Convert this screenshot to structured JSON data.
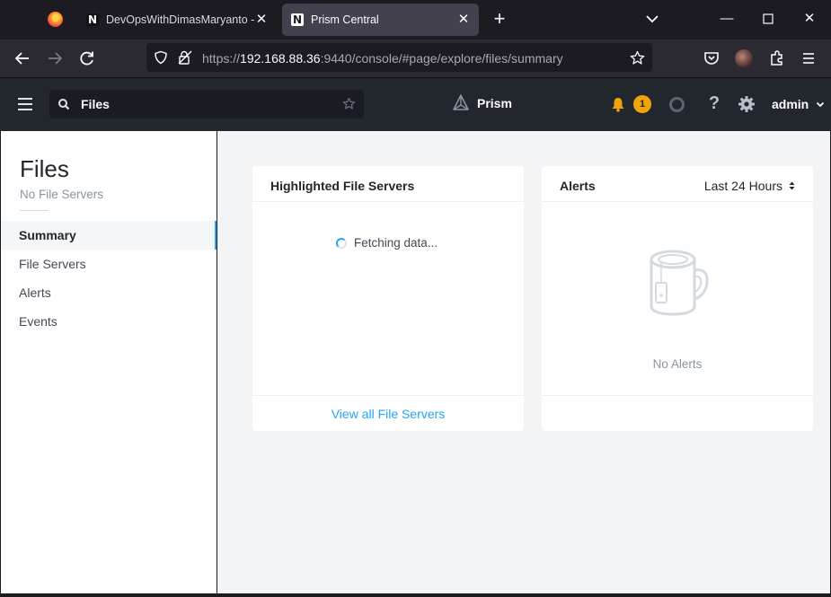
{
  "browser": {
    "tabs": [
      {
        "title": "DevOpsWithDimasMaryanto - N"
      },
      {
        "title": "Prism Central"
      }
    ],
    "url_prefix": "https://",
    "url_host": "192.168.88.36",
    "url_rest": ":9440/console/#page/explore/files/summary"
  },
  "header": {
    "search_value": "Files",
    "brand": "Prism",
    "alert_count": "1",
    "help": "?",
    "user": "admin"
  },
  "sidebar": {
    "title": "Files",
    "subtitle": "No File Servers",
    "items": [
      {
        "label": "Summary",
        "active": true
      },
      {
        "label": "File Servers"
      },
      {
        "label": "Alerts"
      },
      {
        "label": "Events"
      }
    ]
  },
  "main": {
    "file_servers_card": {
      "title": "Highlighted File Servers",
      "loading_text": "Fetching data...",
      "footer_link": "View all File Servers"
    },
    "alerts_card": {
      "title": "Alerts",
      "range": "Last 24 Hours",
      "empty_text": "No Alerts"
    }
  },
  "colors": {
    "accent": "#22a5f7",
    "alert_badge": "#f0a30a",
    "header_bg": "#22272e"
  }
}
